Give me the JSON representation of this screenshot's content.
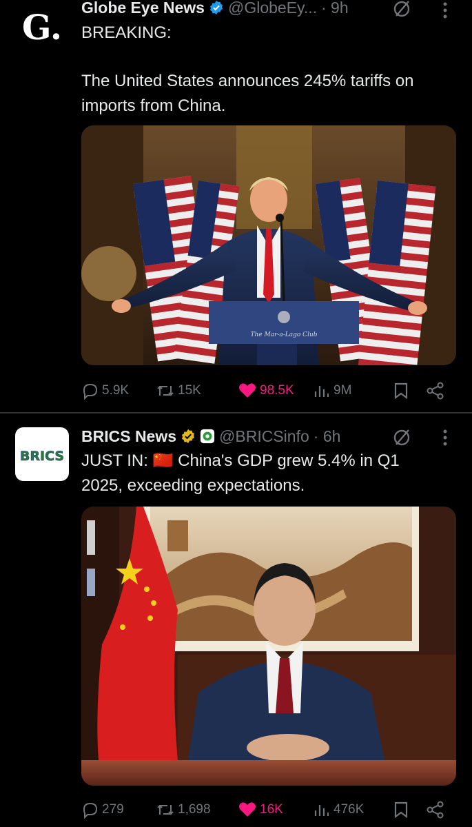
{
  "posts": [
    {
      "author": "Globe Eye News",
      "handle": "@GlobeEy...",
      "time": "· 9h",
      "avatar_text": "G.",
      "line1": "BREAKING:",
      "body": "The United States announces 245% tariffs on imports from China.",
      "stats": {
        "replies": "5.9K",
        "reposts": "15K",
        "likes": "98.5K",
        "views": "9M"
      }
    },
    {
      "author": "BRICS News",
      "handle": "@BRICSinfo",
      "time": "· 6h",
      "avatar_text": "BRICS",
      "body_line1": "JUST IN: 🇨🇳 China's GDP grew 5.4% in Q1",
      "body_line2": "2025, exceeding expectations.",
      "stats": {
        "replies": "279",
        "reposts": "1,698",
        "likes": "16K",
        "views": "476K"
      }
    }
  ],
  "media": {
    "podium_sign": "The Mar-a-Lago Club"
  },
  "colors": {
    "background": "#000000",
    "text": "#e7e9ea",
    "muted": "#71767b",
    "like": "#f91880",
    "verified_blue": "#1d9bf0",
    "verified_gold": "#e2b719"
  },
  "icons": [
    "reply-icon",
    "repost-icon",
    "heart-icon",
    "views-icon",
    "bookmark-icon",
    "share-icon",
    "grok-icon",
    "more-icon",
    "verified-badge-icon"
  ]
}
